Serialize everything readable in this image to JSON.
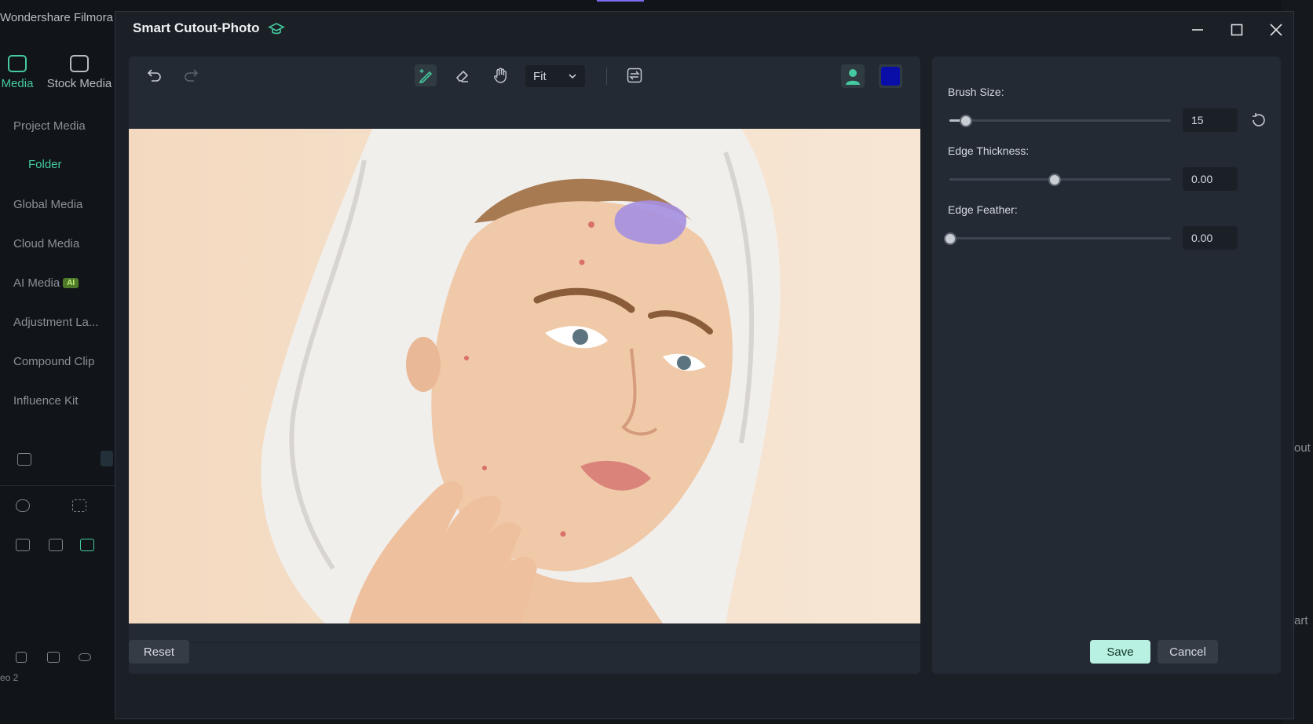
{
  "background": {
    "app_title": "Wondershare Filmora",
    "tabs": [
      {
        "label": "Media",
        "icon": "media-icon"
      },
      {
        "label": "Stock Media",
        "icon": "store-icon"
      }
    ],
    "menu": [
      "Project Media",
      "Folder",
      "Global Media",
      "Cloud Media",
      "AI Media",
      "Adjustment La...",
      "Compound Clip",
      "Influence Kit"
    ],
    "ai_badge": "AI",
    "track_label": "eo 2",
    "right_text_1": "out",
    "right_text_2": "art"
  },
  "dialog": {
    "title": "Smart Cutout-Photo",
    "title_icon": "graduation-cap-icon",
    "window_buttons": [
      "minimize-icon",
      "maximize-icon",
      "close-icon"
    ],
    "toolbar": {
      "zoom_value": "Fit",
      "tools": [
        "undo-icon",
        "redo-icon",
        "smart-brush-icon",
        "eraser-icon",
        "hand-icon",
        "swap-icon",
        "person-preview-icon"
      ],
      "mask_color": "#0a0ea8"
    },
    "panel": {
      "brush_size_label": "Brush Size:",
      "brush_size_value": "15",
      "brush_size_level": 0.07,
      "edge_thickness_label": "Edge Thickness:",
      "edge_thickness_value": "0.00",
      "edge_thickness_level": 0.47,
      "edge_feather_label": "Edge Feather:",
      "edge_feather_value": "0.00",
      "edge_feather_level": 0.0
    },
    "buttons": {
      "reset": "Reset",
      "save": "Save",
      "cancel": "Cancel"
    },
    "colors": {
      "accent": "#45c9a0",
      "save_bg": "#b8f1e1",
      "brush_mark": "#a58fe0"
    }
  }
}
